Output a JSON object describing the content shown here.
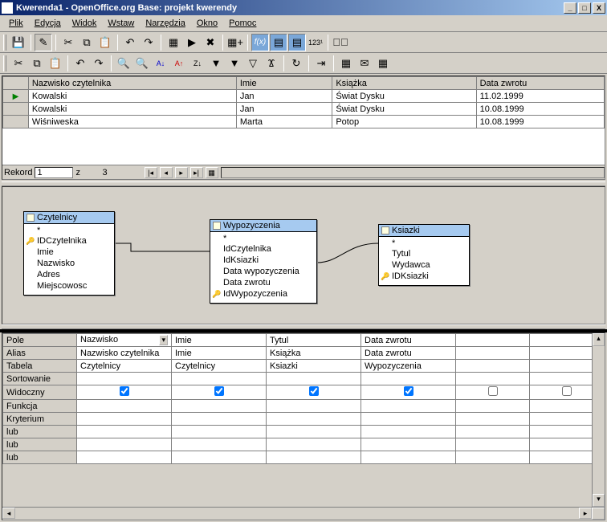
{
  "window": {
    "title": "Kwerenda1 - OpenOffice.org Base: projekt kwerendy"
  },
  "menu": {
    "items": [
      "Plik",
      "Edycja",
      "Widok",
      "Wstaw",
      "Narzędzia",
      "Okno",
      "Pomoc"
    ]
  },
  "toolbar1_icons": [
    "save",
    "edit",
    "undo",
    "redo",
    "cut",
    "copy",
    "paste",
    "undo2",
    "redo2",
    "designview",
    "runquery",
    "clear",
    "addtable",
    "fx",
    "toggle1",
    "toggle2",
    "num",
    "sep",
    "close"
  ],
  "toolbar2_icons": [
    "cut",
    "copy",
    "paste",
    "sep",
    "undo",
    "redo",
    "sep",
    "find",
    "replace",
    "sortasc",
    "sortdesc",
    "sortaz",
    "filter",
    "autofilter",
    "removefilter",
    "funnel",
    "sep",
    "refresh",
    "sep",
    "export",
    "sep",
    "macro",
    "org"
  ],
  "results": {
    "columns": [
      "Nazwisko czytelnika",
      "Imie",
      "Książka",
      "Data zwrotu"
    ],
    "rows": [
      {
        "c0": "Kowalski",
        "c1": "Jan",
        "c2": "Świat Dysku",
        "c3": "11.02.1999"
      },
      {
        "c0": "Kowalski",
        "c1": "Jan",
        "c2": "Świat Dysku",
        "c3": "10.08.1999"
      },
      {
        "c0": "Wiśniweska",
        "c1": "Marta",
        "c2": "Potop",
        "c3": "10.08.1999"
      }
    ]
  },
  "recordnav": {
    "label": "Rekord",
    "current": "1",
    "of_label": "z",
    "total": "3"
  },
  "diagram": {
    "tables": [
      {
        "name": "Czytelnicy",
        "fields": [
          {
            "n": "IDCzytelnika",
            "key": true
          },
          {
            "n": "Imie"
          },
          {
            "n": "Nazwisko"
          },
          {
            "n": "Adres"
          },
          {
            "n": "Miejscowosc"
          }
        ]
      },
      {
        "name": "Wypozyczenia",
        "fields": [
          {
            "n": "IdCzytelnika"
          },
          {
            "n": "IdKsiazki"
          },
          {
            "n": "Data wypozyczenia"
          },
          {
            "n": "Data zwrotu"
          },
          {
            "n": "IdWypozyczenia",
            "key": true
          }
        ]
      },
      {
        "name": "Ksiazki",
        "fields": [
          {
            "n": "Tytul"
          },
          {
            "n": "Wydawca"
          },
          {
            "n": "IDKsiazki",
            "key": true
          }
        ]
      }
    ]
  },
  "design": {
    "row_labels": [
      "Pole",
      "Alias",
      "Tabela",
      "Sortowanie",
      "Widoczny",
      "Funkcja",
      "Kryterium",
      "lub",
      "lub",
      "lub"
    ],
    "columns": [
      {
        "pole": "Nazwisko",
        "alias": "Nazwisko czytelnika",
        "tabela": "Czytelnicy",
        "sort": "",
        "widoczny": true
      },
      {
        "pole": "Imie",
        "alias": "Imie",
        "tabela": "Czytelnicy",
        "sort": "",
        "widoczny": true
      },
      {
        "pole": "Tytul",
        "alias": "Książka",
        "tabela": "Ksiazki",
        "sort": "",
        "widoczny": true
      },
      {
        "pole": "Data zwrotu",
        "alias": "Data zwrotu",
        "tabela": "Wypozyczenia",
        "sort": "",
        "widoczny": true
      },
      {
        "pole": "",
        "alias": "",
        "tabela": "",
        "sort": "",
        "widoczny": false
      },
      {
        "pole": "",
        "alias": "",
        "tabela": "",
        "sort": "",
        "widoczny": false
      }
    ]
  }
}
